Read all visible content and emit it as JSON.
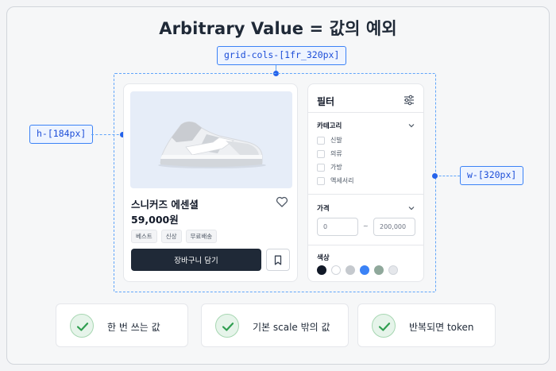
{
  "title": "Arbitrary Value = 값의 예외",
  "annotations": {
    "grid": "grid-cols-[1fr_320px]",
    "height": "h-[184px]",
    "width": "w-[320px]"
  },
  "product": {
    "name": "스니커즈 에센셜",
    "price": "59,000원",
    "badges": [
      "베스트",
      "신상",
      "무료배송"
    ],
    "cart_label": "장바구니 담기"
  },
  "filter": {
    "title": "필터",
    "category": {
      "title": "카테고리",
      "options": [
        "신발",
        "의류",
        "가방",
        "액세서리"
      ]
    },
    "price": {
      "title": "가격",
      "min_placeholder": "0",
      "max_placeholder": "200,000",
      "separator": "~"
    },
    "color": {
      "title": "색상",
      "swatches": [
        "#111827",
        "#ffffff",
        "#d1d5db",
        "#3b82f6",
        "#8fa89b",
        "#e5e7eb"
      ]
    }
  },
  "bottom": [
    "한 번 쓰는 값",
    "기본 scale 밖의 값",
    "반복되면 token"
  ],
  "colors": {
    "accent": "#3b82f6",
    "check": "#2f9e50",
    "button": "#1f2937"
  }
}
